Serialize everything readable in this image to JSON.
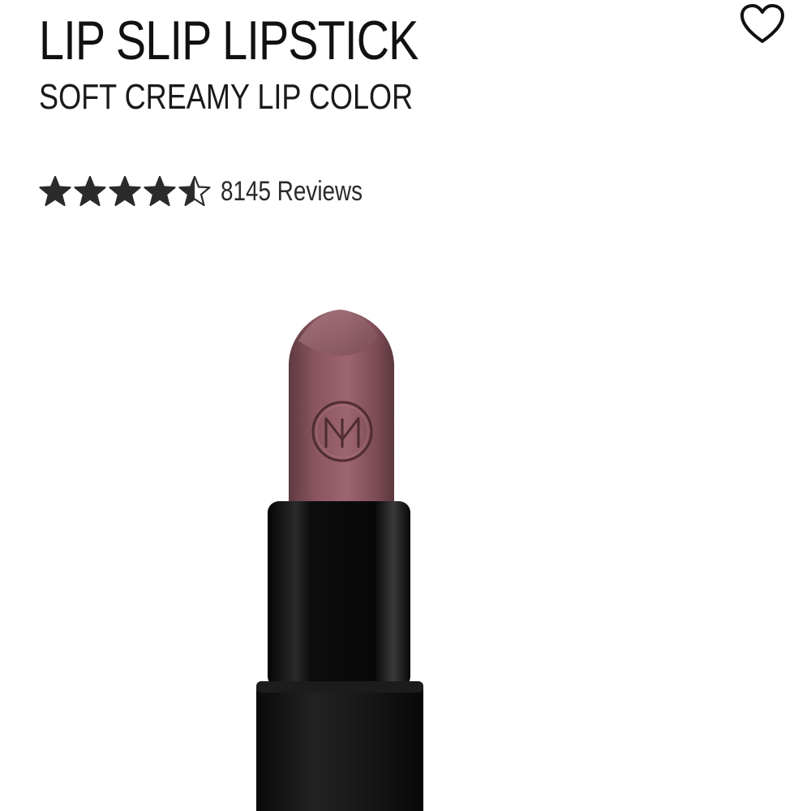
{
  "product": {
    "title": "LIP SLIP LIPSTICK",
    "subtitle": "SOFT CREAMY LIP COLOR"
  },
  "wishlist": {
    "icon": "heart-outline-icon"
  },
  "rating": {
    "value": 4.5,
    "max": 5,
    "reviews_label": "8145 Reviews",
    "star_color": "#2b2b2b"
  },
  "image": {
    "alt": "Lip Slip Lipstick",
    "bullet_color": "#8a5560",
    "case_color": "#111111"
  }
}
